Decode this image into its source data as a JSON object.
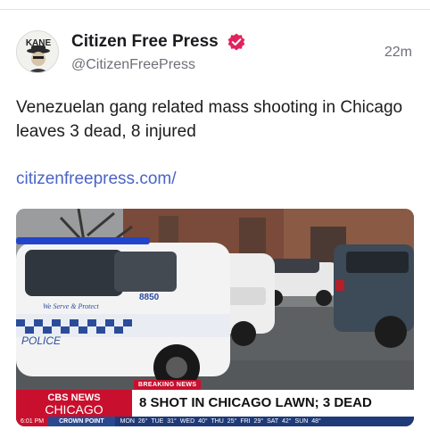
{
  "post": {
    "display_name": "Citizen Free Press",
    "handle": "@CitizenFreePress",
    "time": "22m",
    "avatar_text": "KANE",
    "text": "Venezuelan gang related mass shooting in Chicago leaves 3 dead, 8 injured",
    "link": "citizenfreepress.com/"
  },
  "media": {
    "car_number": "8850",
    "car_slogan": "We Serve & Protect",
    "car_label": "POLICE",
    "breaking_label": "BREAKING NEWS",
    "channel_line1": "CBS NEWS",
    "channel_line2": "CHICAGO",
    "headline": "8 SHOT IN CHICAGO LAWN; 3 DEAD",
    "ticker_time": "6:01 PM",
    "ticker_location": "CROWN POINT",
    "ticker_weather": "MON 26° TUE 31° WED 40° THU 25° FRI 29° SAT 42° SUN 48°"
  },
  "colors": {
    "verified": "#e0245e",
    "link": "#4a63c9",
    "cbs_red": "#c8102e",
    "ticker_blue": "#1f3a78"
  },
  "icons": [
    "verified-badge-icon"
  ]
}
